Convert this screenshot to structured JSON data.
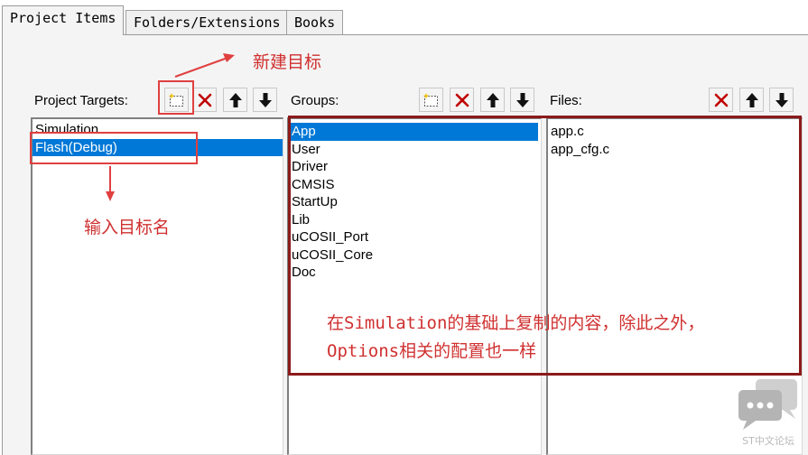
{
  "tabs": [
    {
      "label": "Project Items",
      "active": true
    },
    {
      "label": "Folders/Extensions",
      "active": false
    },
    {
      "label": "Books",
      "active": false
    }
  ],
  "targets": {
    "label": "Project Targets:",
    "items": [
      "Simulation",
      "Flash(Debug)"
    ],
    "selected": 1
  },
  "groups": {
    "label": "Groups:",
    "items": [
      "App",
      "User",
      "Driver",
      "CMSIS",
      "StartUp",
      "Lib",
      "uCOSII_Port",
      "uCOSII_Core",
      "Doc"
    ],
    "selected": 0
  },
  "files": {
    "label": "Files:",
    "items": [
      "app.c",
      "app_cfg.c"
    ]
  },
  "annotations": {
    "new_target": "新建目标",
    "enter_name": "输入目标名",
    "copy_note_line1": "在Simulation的基础上复制的内容，除此之外，",
    "copy_note_line2": "Options相关的配置也一样"
  },
  "watermark": {
    "text": "ST中文论坛"
  },
  "colors": {
    "selection": "#0078d7",
    "annotation": "#d03030",
    "annotation_box": "#8b1a1a"
  },
  "icons": [
    "new-icon",
    "delete-icon",
    "move-up-icon",
    "move-down-icon",
    "chat-bubble-icon"
  ]
}
